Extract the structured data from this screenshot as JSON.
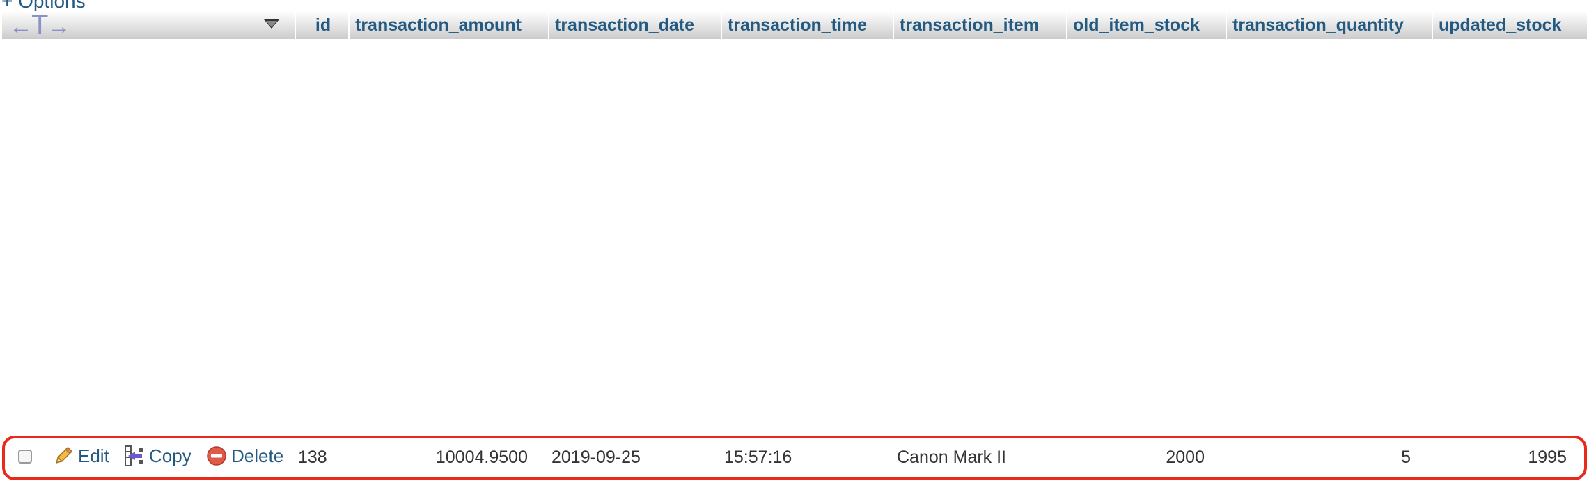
{
  "options_link": "+ Options",
  "header": {
    "arrows_left": "←",
    "arrows_tee": "T",
    "arrows_right": "→",
    "columns": [
      "id",
      "transaction_amount",
      "transaction_date",
      "transaction_time",
      "transaction_item",
      "old_item_stock",
      "transaction_quantity",
      "updated_stock"
    ]
  },
  "row": {
    "actions": {
      "edit": "Edit",
      "copy": "Copy",
      "delete": "Delete"
    },
    "cells": {
      "id": "138",
      "transaction_amount": "10004.9500",
      "transaction_date": "2019-09-25",
      "transaction_time": "15:57:16",
      "transaction_item": "Canon Mark II",
      "old_item_stock": "2000",
      "transaction_quantity": "5",
      "updated_stock": "1995"
    }
  },
  "colors": {
    "link": "#235a81",
    "highlight_border": "#e8291c",
    "header_gradient_top": "#ffffff",
    "header_gradient_bottom": "#cccccc"
  },
  "icons": {
    "edit": "pencil-icon",
    "copy": "insert-row-icon",
    "delete": "delete-circle-icon",
    "sort": "sort-down-caret-icon"
  }
}
